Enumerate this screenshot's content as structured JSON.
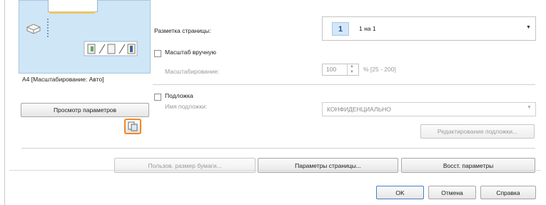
{
  "page_layout": {
    "label": "Разметка страницы:",
    "selected_number": "1",
    "selected_value": "1 на 1"
  },
  "scaling": {
    "manual_label": "Масштаб вручную",
    "scaling_label": "Масштабирование:",
    "value": "100",
    "range": "% [25 - 200]",
    "checked": false
  },
  "watermark": {
    "checkbox_label": "Подложка",
    "name_label": "Имя подложки:",
    "selected": "КОНФИДЕНЦИАЛЬНО",
    "edit_button": "Редактирование подложки...",
    "checked": false
  },
  "preview": {
    "caption": "A4 [Масштабирование: Авто]",
    "view_settings_button": "Просмотр параметров"
  },
  "buttons": {
    "custom_paper": "Пользов. размер бумаги...",
    "page_options": "Параметры страницы...",
    "restore_defaults": "Восст. параметры",
    "ok": "OK",
    "cancel": "Отмена",
    "help": "Справка"
  },
  "colors": {
    "highlight": "#f08a24",
    "preview_bg": "#cfe6f7",
    "chip_bg": "#d4e7f8"
  }
}
